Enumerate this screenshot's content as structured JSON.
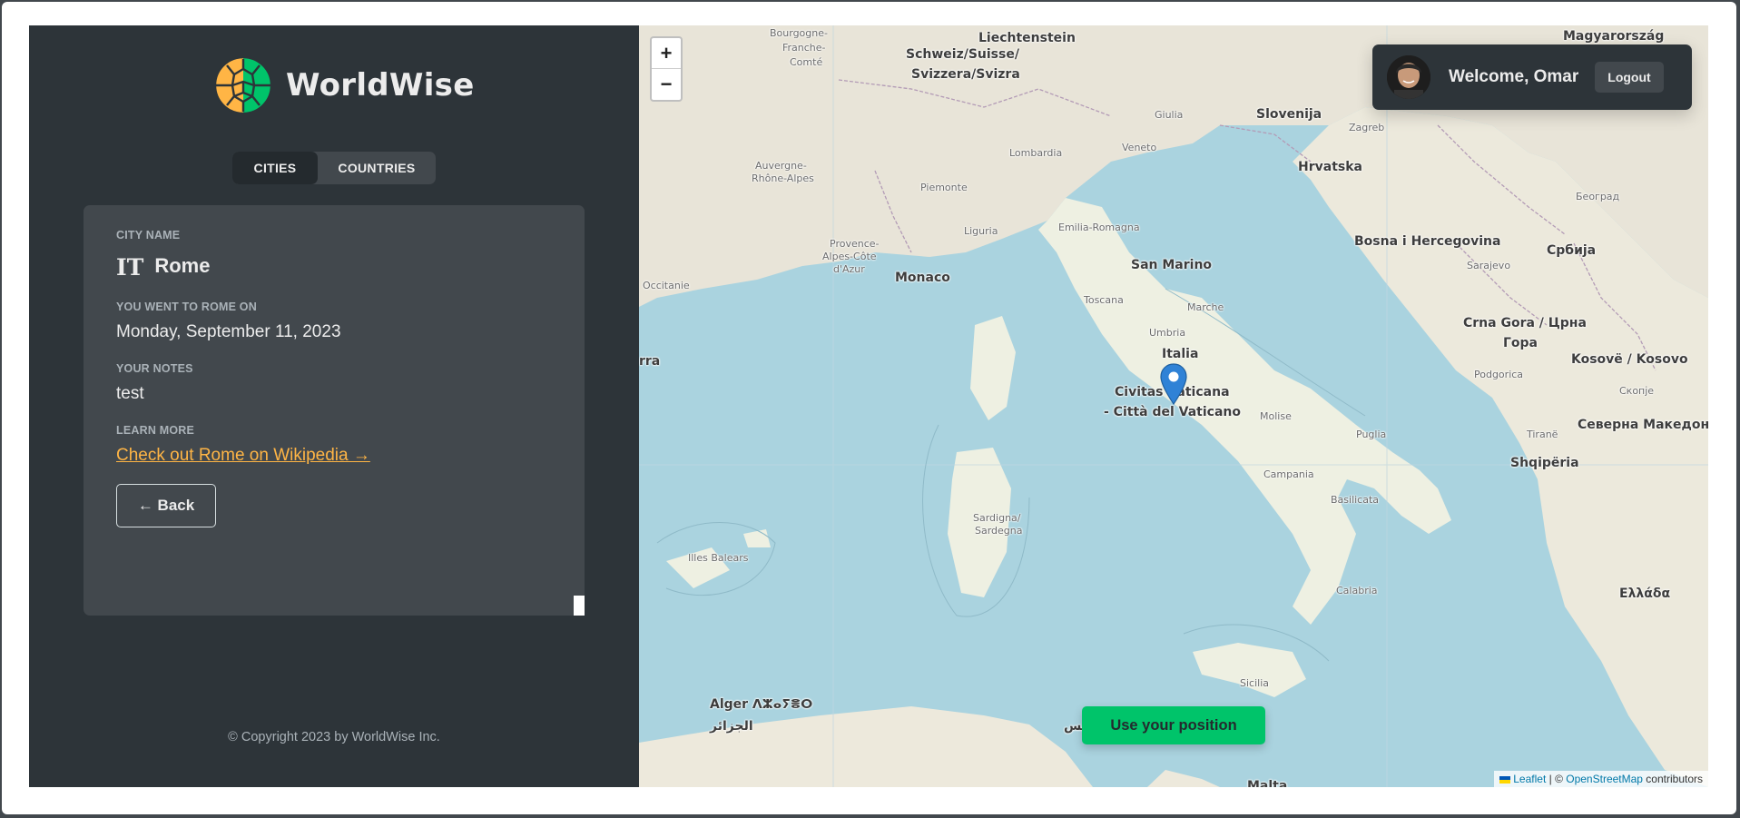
{
  "app": {
    "name": "WorldWise",
    "colors": {
      "brand_green": "#00c46a",
      "brand_yellow": "#ffb545",
      "dark_bg": "#2d3439",
      "card_bg": "#42484d"
    }
  },
  "nav": {
    "cities_label": "Cities",
    "countries_label": "Countries",
    "active": "Cities"
  },
  "city": {
    "name_label": "City name",
    "flag_code": "IT",
    "name": "Rome",
    "date_label": "You went to Rome on",
    "date": "Monday, September 11, 2023",
    "notes_label": "Your notes",
    "notes": "test",
    "learn_label": "Learn more",
    "wiki_link": "Check out Rome on Wikipedia →",
    "back_label": "← Back"
  },
  "footer": {
    "copyright": "© Copyright 2023 by WorldWise Inc."
  },
  "map": {
    "zoom_in": "+",
    "zoom_out": "−",
    "marker_icon": "map-pin-icon",
    "use_position_label": "Use your position",
    "attribution": {
      "leaflet": "Leaflet",
      "sep": " | © ",
      "osm": "OpenStreetMap",
      "tail": " contributors"
    },
    "labels": {
      "liechtenstein": "Liechtenstein",
      "schweiz": "Schweiz/Suisse/",
      "svizzera": "Svizzera/Svizra",
      "magyarorszag": "Magyarország",
      "slovenija": "Slovenija",
      "zagreb": "Zagreb",
      "hrvatska": "Hrvatska",
      "beograd": "Београд",
      "bosna": "Bosna i Hercegovina",
      "srbija": "Србија",
      "sarajevo": "Sarajevo",
      "crna_gora": "Crna Gora / Црна",
      "gora": "Гора",
      "kosovo": "Kosovë / Kosovo",
      "podgorica": "Podgorica",
      "skopje": "Скопје",
      "makedonija": "Северна Македонија",
      "tirane": "Tiranë",
      "shqiperia": "Shqipëria",
      "ellada": "Ελλάδα",
      "monaco": "Monaco",
      "san_marino": "San Marino",
      "italia": "Italia",
      "vaticano1": "Civitas Vaticana",
      "vaticano2": "- Città del Vaticano",
      "sardigna": "Sardigna/",
      "sardegna": "Sardegna",
      "illes_balears": "Illes Balears",
      "alger": "Alger ⴷⵣⴰⵢⴻⵔ",
      "aljazair": "الجزائر",
      "tunis": "تونس",
      "malta": "Malta",
      "rra": "rra",
      "lombardia": "Lombardia",
      "veneto": "Veneto",
      "piemonte": "Piemonte",
      "liguria": "Liguria",
      "emilia": "Emilia-Romagna",
      "toscana": "Toscana",
      "umbria": "Umbria",
      "marche": "Marche",
      "molise": "Molise",
      "puglia": "Puglia",
      "basilicata": "Basilicata",
      "campania": "Campania",
      "calabria": "Calabria",
      "sicilia": "Sicilia",
      "auvergne": "Auvergne-",
      "rhone": "Rhône-Alpes",
      "provence": "Provence-",
      "alpes": "Alpes-Côte",
      "dazur": "d'Azur",
      "occitanie": "Occitanie",
      "bourgogne": "Bourgogne-",
      "franche": "Franche-",
      "comte": "Comté",
      "giulia": "Giulia"
    }
  },
  "user": {
    "welcome": "Welcome, Omar",
    "logout": "Logout"
  }
}
